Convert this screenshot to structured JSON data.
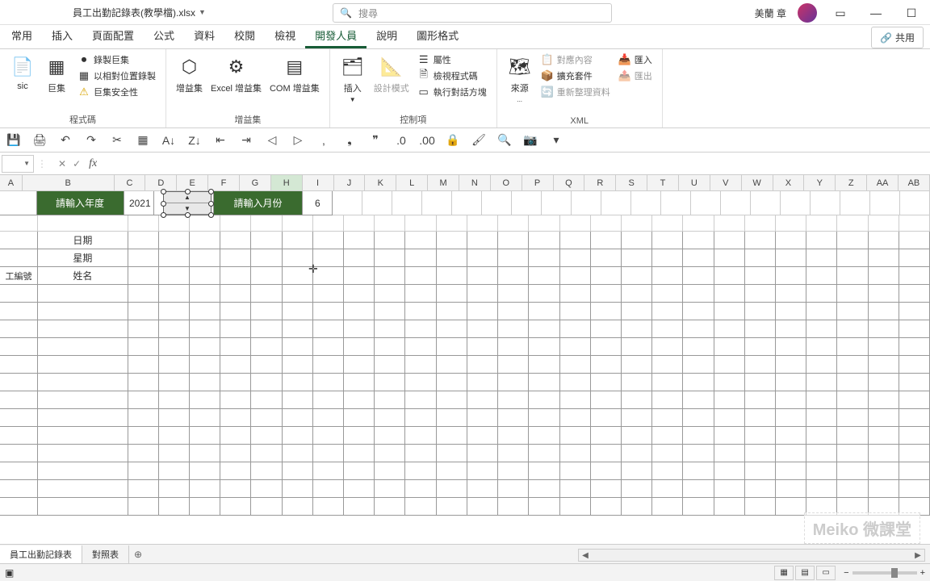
{
  "title": {
    "filename": "員工出勤記錄表(教學檔).xlsx"
  },
  "search": {
    "placeholder": "搜尋"
  },
  "user": {
    "name": "美蘭 章"
  },
  "tabs": {
    "home": "常用",
    "insert": "插入",
    "layout": "頁面配置",
    "formulas": "公式",
    "data": "資料",
    "review": "校閱",
    "view": "檢視",
    "developer": "開發人員",
    "help": "說明",
    "shapefmt": "圖形格式"
  },
  "share": "共用",
  "ribbon": {
    "code": {
      "sic": "sic",
      "macros": "巨集",
      "record": "錄製巨集",
      "relative": "以相對位置錄製",
      "security": "巨集安全性",
      "label": "程式碼"
    },
    "addins": {
      "addin": "增益集",
      "excel": "Excel 增益集",
      "com": "COM 增益集",
      "label": "增益集"
    },
    "controls": {
      "insert": "插入",
      "design": "設計模式",
      "props": "屬性",
      "viewcode": "檢視程式碼",
      "rundlg": "執行對話方塊",
      "label": "控制項"
    },
    "xml": {
      "source": "來源",
      "mapprops": "對應內容",
      "expand": "擴充套件",
      "refresh": "重新整理資料",
      "import": "匯入",
      "export": "匯出",
      "label": "XML"
    }
  },
  "columns": [
    "A",
    "B",
    "C",
    "D",
    "E",
    "F",
    "G",
    "H",
    "I",
    "J",
    "K",
    "L",
    "M",
    "N",
    "O",
    "P",
    "Q",
    "R",
    "S",
    "T",
    "U",
    "V",
    "W",
    "X",
    "Y",
    "Z",
    "AA",
    "AB"
  ],
  "sheet": {
    "year_label": "請輸入年度",
    "year_value": "2021",
    "month_label": "請輸入月份",
    "month_value": "6",
    "row_date": "日期",
    "row_weekday": "星期",
    "row_empno": "工編號",
    "row_name": "姓名"
  },
  "sheets": {
    "s1": "員工出勤記錄表",
    "s2": "對照表"
  },
  "watermark": "Meiko 微課堂"
}
